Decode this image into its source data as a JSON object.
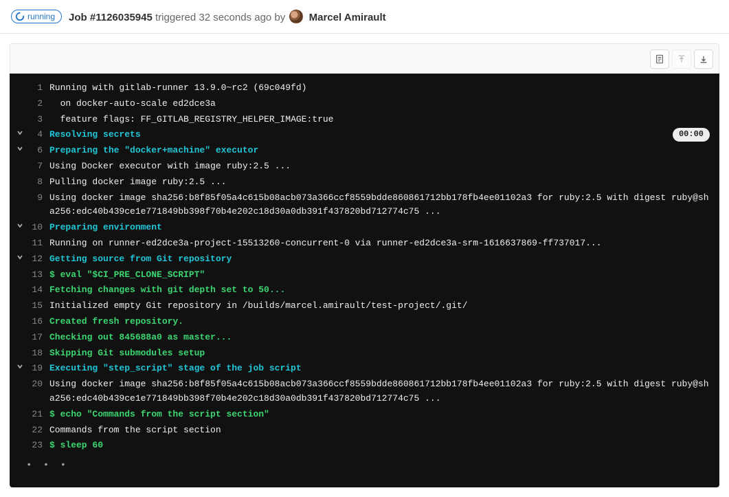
{
  "header": {
    "status": "running",
    "job_prefix": "Job ",
    "job_id": "#1126035945",
    "triggered_text": " triggered 32 seconds ago by ",
    "author": "Marcel Amirault"
  },
  "toolbar": {
    "raw_icon": "document",
    "scroll_up_icon": "arrow-up",
    "scroll_down_icon": "arrow-down"
  },
  "log": {
    "lines": [
      {
        "n": 1,
        "chev": false,
        "cls": "",
        "t": "Running with gitlab-runner 13.9.0~rc2 (69c049fd)"
      },
      {
        "n": 2,
        "chev": false,
        "cls": "",
        "t": "  on docker-auto-scale ed2dce3a"
      },
      {
        "n": 3,
        "chev": false,
        "cls": "",
        "t": "  feature flags: FF_GITLAB_REGISTRY_HELPER_IMAGE:true"
      },
      {
        "n": 4,
        "chev": true,
        "cls": "section",
        "t": "Resolving secrets",
        "dur": "00:00"
      },
      {
        "n": 6,
        "chev": true,
        "cls": "section",
        "t": "Preparing the \"docker+machine\" executor"
      },
      {
        "n": 7,
        "chev": false,
        "cls": "",
        "t": "Using Docker executor with image ruby:2.5 ..."
      },
      {
        "n": 8,
        "chev": false,
        "cls": "",
        "t": "Pulling docker image ruby:2.5 ..."
      },
      {
        "n": 9,
        "chev": false,
        "cls": "",
        "t": "Using docker image sha256:b8f85f05a4c615b08acb073a366ccf8559bdde860861712bb178fb4ee01102a3 for ruby:2.5 with digest ruby@sha256:edc40b439ce1e771849bb398f70b4e202c18d30a0db391f437820bd712774c75 ..."
      },
      {
        "n": 10,
        "chev": true,
        "cls": "section",
        "t": "Preparing environment"
      },
      {
        "n": 11,
        "chev": false,
        "cls": "",
        "t": "Running on runner-ed2dce3a-project-15513260-concurrent-0 via runner-ed2dce3a-srm-1616637869-ff737017..."
      },
      {
        "n": 12,
        "chev": true,
        "cls": "section",
        "t": "Getting source from Git repository"
      },
      {
        "n": 13,
        "chev": false,
        "cls": "green",
        "t": "$ eval \"$CI_PRE_CLONE_SCRIPT\""
      },
      {
        "n": 14,
        "chev": false,
        "cls": "green",
        "t": "Fetching changes with git depth set to 50..."
      },
      {
        "n": 15,
        "chev": false,
        "cls": "",
        "t": "Initialized empty Git repository in /builds/marcel.amirault/test-project/.git/"
      },
      {
        "n": 16,
        "chev": false,
        "cls": "green",
        "t": "Created fresh repository."
      },
      {
        "n": 17,
        "chev": false,
        "cls": "green",
        "t": "Checking out 845688a0 as master..."
      },
      {
        "n": 18,
        "chev": false,
        "cls": "green",
        "t": "Skipping Git submodules setup"
      },
      {
        "n": 19,
        "chev": true,
        "cls": "section",
        "t": "Executing \"step_script\" stage of the job script"
      },
      {
        "n": 20,
        "chev": false,
        "cls": "",
        "t": "Using docker image sha256:b8f85f05a4c615b08acb073a366ccf8559bdde860861712bb178fb4ee01102a3 for ruby:2.5 with digest ruby@sha256:edc40b439ce1e771849bb398f70b4e202c18d30a0db391f437820bd712774c75 ..."
      },
      {
        "n": 21,
        "chev": false,
        "cls": "green",
        "t": "$ echo \"Commands from the script section\""
      },
      {
        "n": 22,
        "chev": false,
        "cls": "",
        "t": "Commands from the script section"
      },
      {
        "n": 23,
        "chev": false,
        "cls": "green",
        "t": "$ sleep 60"
      }
    ],
    "loading_dots": "• • •"
  }
}
